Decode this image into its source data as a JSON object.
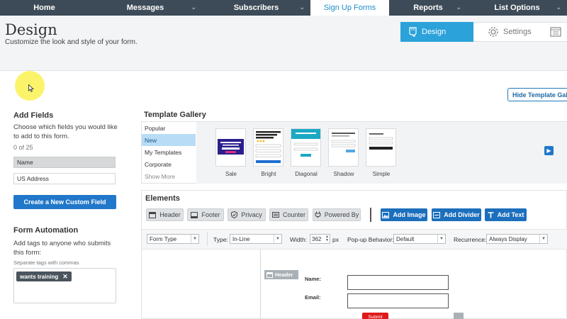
{
  "nav": {
    "items": [
      {
        "label": "Home",
        "dropdown": false,
        "active": false
      },
      {
        "label": "Messages",
        "dropdown": true,
        "active": false
      },
      {
        "label": "Subscribers",
        "dropdown": true,
        "active": false
      },
      {
        "label": "Sign Up Forms",
        "dropdown": false,
        "active": true
      },
      {
        "label": "Reports",
        "dropdown": true,
        "active": false
      },
      {
        "label": "List Options",
        "dropdown": true,
        "active": false
      }
    ]
  },
  "header": {
    "title": "Design",
    "subtitle": "Customize the look and style of your form."
  },
  "steps": {
    "design": "Design",
    "settings": "Settings"
  },
  "gallery_toggle": "Hide Template Gallery",
  "add_fields": {
    "heading": "Add Fields",
    "description": "Choose which fields you would like to add to this form.",
    "count": "0 of 25",
    "fields": [
      "Name",
      "US Address"
    ],
    "create_button": "Create a New Custom Field"
  },
  "automation": {
    "heading": "Form Automation",
    "description": "Add tags to anyone who submits this form:",
    "hint": "Separate tags with commas",
    "tags": [
      "wants training"
    ]
  },
  "gallery": {
    "title": "Template Gallery",
    "categories": [
      "Popular",
      "New",
      "My Templates",
      "Corporate"
    ],
    "selected_category": "New",
    "show_more": "Show More",
    "templates": [
      "Sale",
      "Bright",
      "Diagonal",
      "Shadow",
      "Simple"
    ]
  },
  "elements": {
    "title": "Elements",
    "basic": [
      "Header",
      "Footer",
      "Privacy",
      "Counter",
      "Powered By"
    ],
    "add": [
      "Add Image",
      "Add Divider",
      "Add Text"
    ]
  },
  "settings": {
    "form_type": "Form Type",
    "type_label": "Type:",
    "type_value": "In-Line",
    "width_label": "Width:",
    "width_value": "362",
    "width_unit": "px",
    "popup_label": "Pop-up Behavior:",
    "popup_value": "Default",
    "recurrence_label": "Recurrence:",
    "recurrence_value": "Always Display"
  },
  "canvas": {
    "header_tag": "Header",
    "name_label": "Name:",
    "email_label": "Email:",
    "submit_label": "Submit"
  },
  "colors": {
    "nav_bg": "#3d4a57",
    "accent": "#2ba2d9",
    "primary_button": "#1c6fbd",
    "submit": "#e01a1a",
    "highlight": "#fbf35a"
  }
}
